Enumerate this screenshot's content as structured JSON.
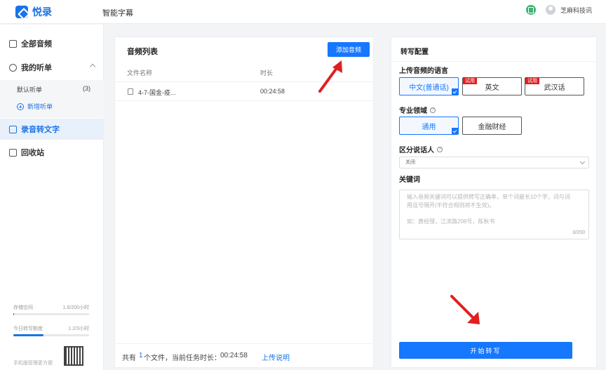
{
  "app": {
    "name": "悦录",
    "page_label": "智能字幕",
    "user_name": "芝麻科技讯"
  },
  "sidebar": {
    "items": [
      {
        "label": "全部音频"
      },
      {
        "label": "我的听单"
      },
      {
        "label": "录音转文字"
      },
      {
        "label": "回收站"
      }
    ],
    "sub_items": [
      {
        "label": "默认听单",
        "count": "(3)"
      }
    ],
    "new_list_label": "新增听单",
    "storage": {
      "label": "存储空间",
      "value": "1.6/200小时",
      "fraction": 0.008
    },
    "quota": {
      "label": "今日转写额度",
      "value": "1.2/3小时",
      "fraction": 0.4
    },
    "qr_caption": "手机版管理更方便"
  },
  "audio_list": {
    "title": "音频列表",
    "add_button": "添加音频",
    "columns": [
      "文件名称",
      "时长"
    ],
    "rows": [
      {
        "name": "4-7-国金-疫...",
        "duration": "00:24:58"
      }
    ],
    "footer": {
      "prefix": "共有",
      "count": "1",
      "middle": "个文件，当前任务时长：",
      "duration": "00:24:58",
      "link": "上传说明"
    }
  },
  "config": {
    "title": "转写配置",
    "language": {
      "label": "上传音频的语言",
      "options": [
        {
          "label": "中文(普通话)",
          "selected": true,
          "badge": ""
        },
        {
          "label": "英文",
          "selected": false,
          "badge": "试用"
        },
        {
          "label": "武汉话",
          "selected": false,
          "badge": "试用"
        }
      ]
    },
    "domain": {
      "label": "专业领域",
      "options": [
        {
          "label": "通用",
          "selected": true
        },
        {
          "label": "金融财经",
          "selected": false
        }
      ]
    },
    "speaker": {
      "label": "区分说话人",
      "value": "关闭"
    },
    "keywords": {
      "label": "关键词",
      "placeholder_line1": "输入音频关键词可以提供转写正确率，单个词最长10个字，词与词",
      "placeholder_line2": "用逗号隔开(不符合规则将不生效)。",
      "placeholder_example": "如：黄经理，江滨路208号，陈秋书",
      "counter": "0/200"
    },
    "start_button": "开始转写"
  },
  "colors": {
    "accent": "#1677ff",
    "trial_badge": "#e02020",
    "arrow": "#e02020"
  }
}
